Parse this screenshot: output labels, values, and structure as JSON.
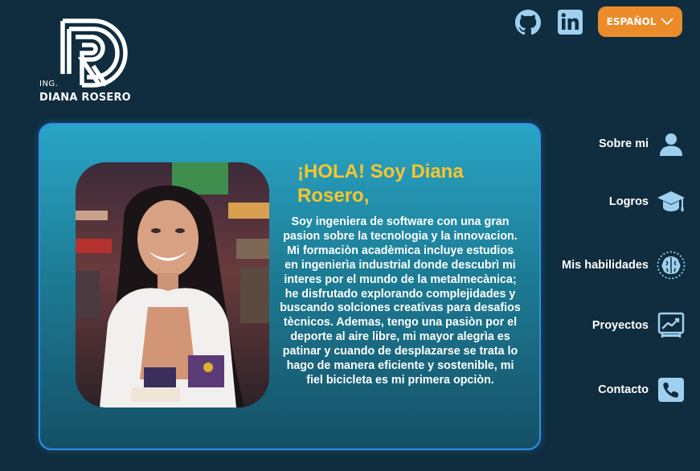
{
  "brand": {
    "prefix": "ING.",
    "name": "DIANA ROSERO",
    "monogram_icon": "dr-monogram-logo"
  },
  "header": {
    "social": [
      {
        "name": "github",
        "icon": "github-icon"
      },
      {
        "name": "linkedin",
        "icon": "linkedin-icon"
      }
    ],
    "language_button": {
      "label": "ESPAÑOL",
      "icon": "chevron-down-icon"
    }
  },
  "hero": {
    "greeting": "¡HOLA! Soy Diana Rosero,",
    "bio": "Soy ingeniera de software con una gran pasion sobre la tecnologia y la innovacion. Mi formaciòn acadèmica incluye estudios en ingenierìa industrial donde descubrì mi interes por el mundo de la metalmecànica; he disfrutado explorando complejidades y buscando solciones creativas para desafios tècnicos. Ademas, tengo una pasiòn por el deporte al aire libre, mi mayor alegrìa es patinar y cuando de desplazarse se trata lo hago de manera eficiente y sostenible, mi fiel bicicleta es mi primera opciòn."
  },
  "nav": {
    "items": [
      {
        "label": "Sobre mi",
        "icon": "user-icon"
      },
      {
        "label": "Logros",
        "icon": "graduation-cap-icon"
      },
      {
        "label": "Mis  habilidades",
        "icon": "brain-icon"
      },
      {
        "label": "Proyectos",
        "icon": "chart-board-icon"
      },
      {
        "label": "Contacto",
        "icon": "phone-icon"
      }
    ]
  },
  "colors": {
    "background": "#0f2d3e",
    "accent_orange": "#eb8b2a",
    "greeting_yellow": "#f7c52d",
    "card_border": "#2f8fe8",
    "icon_blue": "#9fd0ef"
  }
}
